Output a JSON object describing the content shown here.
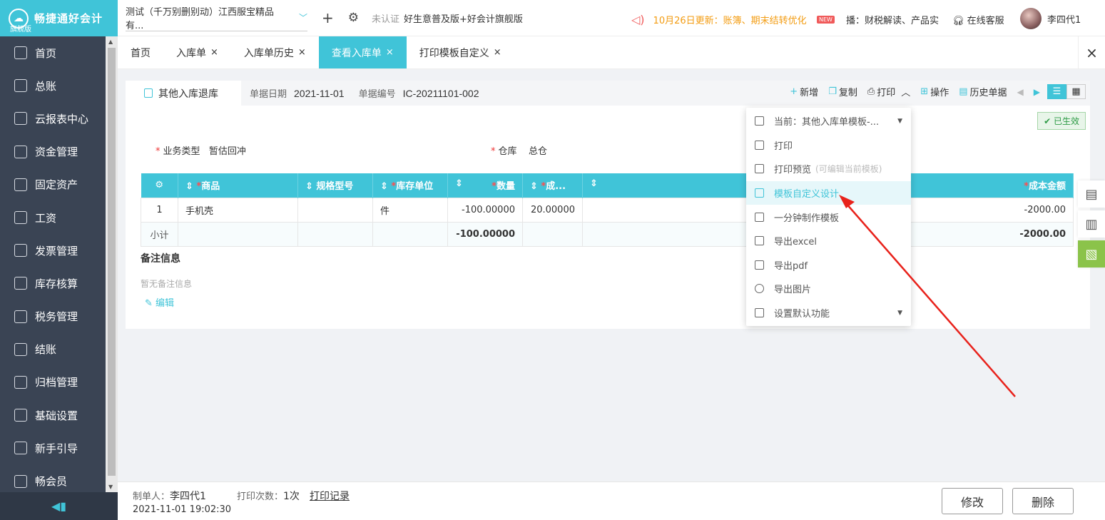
{
  "logo": {
    "name": "畅捷通好会计",
    "sub": "旗舰版"
  },
  "sidebar": {
    "items": [
      {
        "label": "首页"
      },
      {
        "label": "总账"
      },
      {
        "label": "云报表中心"
      },
      {
        "label": "资金管理"
      },
      {
        "label": "固定资产"
      },
      {
        "label": "工资"
      },
      {
        "label": "发票管理"
      },
      {
        "label": "库存核算"
      },
      {
        "label": "税务管理"
      },
      {
        "label": "结账"
      },
      {
        "label": "归档管理"
      },
      {
        "label": "基础设置"
      },
      {
        "label": "新手引导"
      },
      {
        "label": "畅会员"
      }
    ]
  },
  "header": {
    "company": "测试（千万别删别动）江西服宝精品有...",
    "verify": "未认证",
    "edition": "好生意普及版+好会计旗舰版",
    "notice": "10月26日更新：账簿、期末结转优化",
    "broadcast_badge": "NEW",
    "broadcast": "播：财税解读、产品实",
    "service": "在线客服",
    "user": "李四代1"
  },
  "tabs": [
    {
      "label": "首页",
      "closable": false
    },
    {
      "label": "入库单",
      "closable": true
    },
    {
      "label": "入库单历史",
      "closable": true
    },
    {
      "label": "查看入库单",
      "closable": true,
      "active": true
    },
    {
      "label": "打印模板自定义",
      "closable": true
    }
  ],
  "doc": {
    "type": "其他入库退库",
    "date_label": "单据日期",
    "date": "2021-11-01",
    "no_label": "单据编号",
    "no": "IC-20211101-002",
    "status": "已生效",
    "biz_label": "业务类型",
    "biz": "暂估回冲",
    "wh_label": "仓库",
    "wh": "总仓"
  },
  "toolbar": {
    "new": "新增",
    "copy": "复制",
    "print": "打印",
    "ops": "操作",
    "history": "历史单据"
  },
  "table": {
    "headers": [
      "商品",
      "规格型号",
      "库存单位",
      "数量",
      "成...",
      "成本金额"
    ],
    "rows": [
      {
        "idx": "1",
        "goods": "手机壳",
        "spec": "",
        "unit": "件",
        "qty": "-100.00000",
        "cost": "20.00000",
        "amount": "-2000.00"
      }
    ],
    "subtotal": {
      "label": "小计",
      "qty": "-100.00000",
      "amount": "-2000.00"
    }
  },
  "remark": {
    "title": "备注信息",
    "empty": "暂无备注信息",
    "edit": "编辑"
  },
  "dropdown": {
    "items": [
      {
        "label": "当前：其他入库单模板-...",
        "hint": ""
      },
      {
        "label": "打印",
        "hint": ""
      },
      {
        "label": "打印预览",
        "hint": "(可编辑当前模板)"
      },
      {
        "label": "模板自定义设计",
        "hint": ""
      },
      {
        "label": "一分钟制作模板",
        "hint": ""
      },
      {
        "label": "导出excel",
        "hint": ""
      },
      {
        "label": "导出pdf",
        "hint": ""
      },
      {
        "label": "导出图片",
        "hint": ""
      },
      {
        "label": "设置默认功能",
        "hint": ""
      }
    ]
  },
  "footer": {
    "maker_label": "制单人：",
    "maker": "李四代1",
    "time": "2021-11-01 19:02:30",
    "count_label": "打印次数：",
    "count": "1次",
    "records": "打印记录",
    "edit": "修改",
    "delete": "删除"
  }
}
